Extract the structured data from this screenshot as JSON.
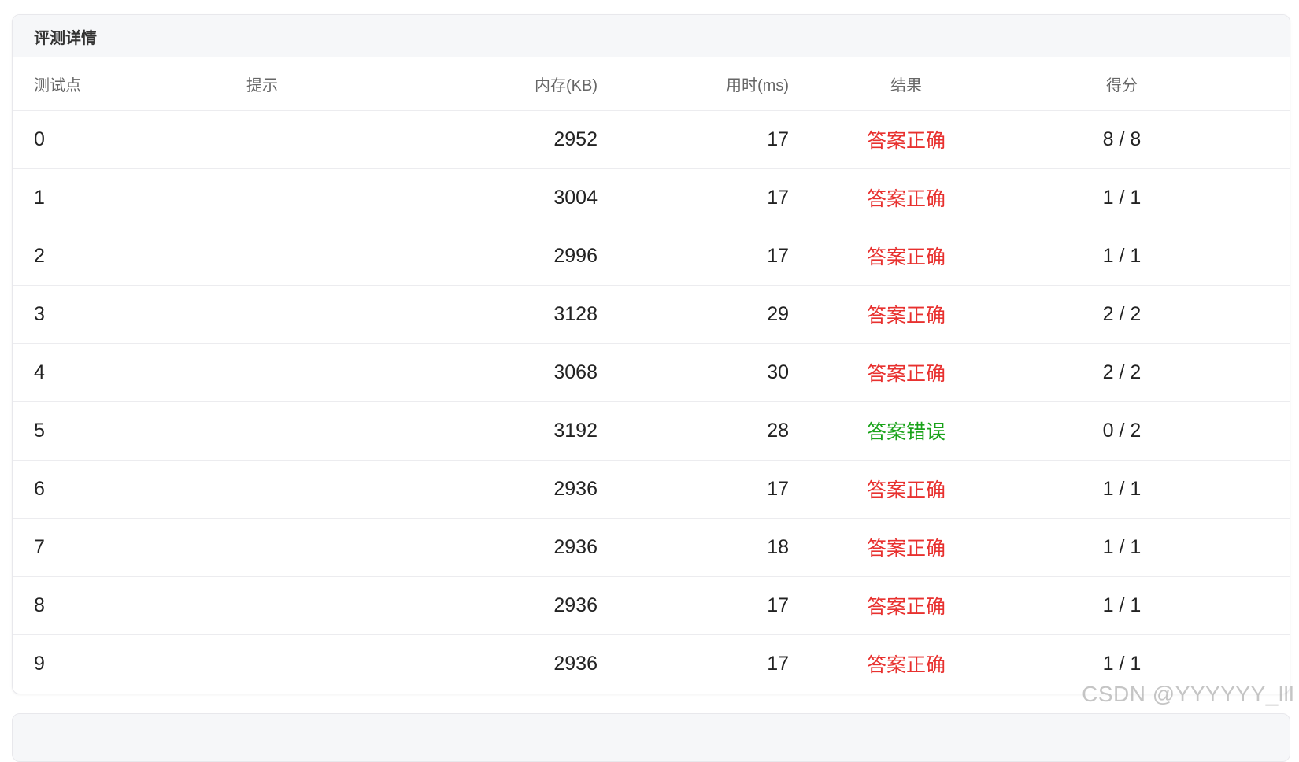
{
  "card": {
    "title": "评测详情"
  },
  "table": {
    "headers": {
      "id": "测试点",
      "hint": "提示",
      "memory": "内存(KB)",
      "time": "用时(ms)",
      "result": "结果",
      "score": "得分"
    },
    "rows": [
      {
        "id": "0",
        "hint": "",
        "memory": "2952",
        "time": "17",
        "result": "答案正确",
        "status": "correct",
        "score": "8 / 8"
      },
      {
        "id": "1",
        "hint": "",
        "memory": "3004",
        "time": "17",
        "result": "答案正确",
        "status": "correct",
        "score": "1 / 1"
      },
      {
        "id": "2",
        "hint": "",
        "memory": "2996",
        "time": "17",
        "result": "答案正确",
        "status": "correct",
        "score": "1 / 1"
      },
      {
        "id": "3",
        "hint": "",
        "memory": "3128",
        "time": "29",
        "result": "答案正确",
        "status": "correct",
        "score": "2 / 2"
      },
      {
        "id": "4",
        "hint": "",
        "memory": "3068",
        "time": "30",
        "result": "答案正确",
        "status": "correct",
        "score": "2 / 2"
      },
      {
        "id": "5",
        "hint": "",
        "memory": "3192",
        "time": "28",
        "result": "答案错误",
        "status": "wrong",
        "score": "0 / 2"
      },
      {
        "id": "6",
        "hint": "",
        "memory": "2936",
        "time": "17",
        "result": "答案正确",
        "status": "correct",
        "score": "1 / 1"
      },
      {
        "id": "7",
        "hint": "",
        "memory": "2936",
        "time": "18",
        "result": "答案正确",
        "status": "correct",
        "score": "1 / 1"
      },
      {
        "id": "8",
        "hint": "",
        "memory": "2936",
        "time": "17",
        "result": "答案正确",
        "status": "correct",
        "score": "1 / 1"
      },
      {
        "id": "9",
        "hint": "",
        "memory": "2936",
        "time": "17",
        "result": "答案正确",
        "status": "correct",
        "score": "1 / 1"
      }
    ]
  },
  "colors": {
    "correct": "#e8312f",
    "wrong": "#1aa31a"
  },
  "watermark": "CSDN @YYYYYY_lll"
}
